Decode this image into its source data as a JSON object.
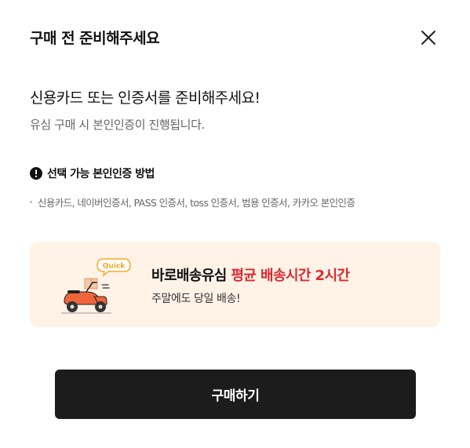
{
  "modal": {
    "title": "구매 전 준비해주세요",
    "close_icon": "close-icon"
  },
  "intro": {
    "headline": "신용카드 또는 인증서를 준비해주세요!",
    "subline": "유심 구매 시 본인인증이 진행됩니다."
  },
  "methods": {
    "title_icon": "warning-circle-icon",
    "title": "선택 가능 본인인증 방법",
    "list": "신용카드, 네이버인증서, PASS 인증서, toss 인증서, 범용 인증서, 카카오 본인인증"
  },
  "quick_delivery": {
    "badge": "Quick",
    "title_part1": "바로배송유심",
    "title_part2": "평균 배송시간 2시간",
    "subtitle": "주말에도 당일 배송!",
    "illustration": "delivery-scooter-icon"
  },
  "purchase": {
    "button_label": "구매하기"
  },
  "colors": {
    "accent_red": "#e0282e",
    "quick_box_bg": "#fff3e8",
    "button_bg": "#1c1c1c",
    "scooter_orange": "#f0643c",
    "badge_yellow": "#f7a823"
  }
}
